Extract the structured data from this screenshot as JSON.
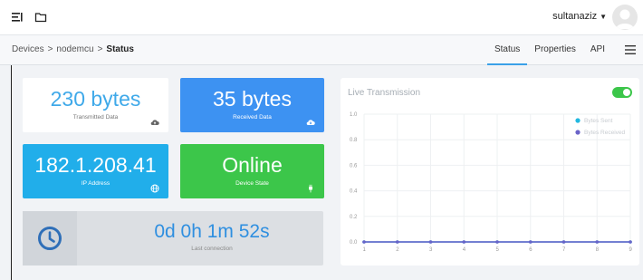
{
  "topbar": {
    "username": "sultanaziz"
  },
  "breadcrumb": {
    "items": [
      "Devices",
      "nodemcu"
    ],
    "separator": ">",
    "current": "Status"
  },
  "tabs": [
    {
      "label": "Status",
      "active": true
    },
    {
      "label": "Properties",
      "active": false
    },
    {
      "label": "API",
      "active": false
    }
  ],
  "tiles": {
    "transmitted": {
      "value": "230 bytes",
      "label": "Transmitted Data",
      "icon": "cloud-upload-icon"
    },
    "received": {
      "value": "35 bytes",
      "label": "Received Data",
      "icon": "cloud-download-icon"
    },
    "ip": {
      "value": "182.1.208.41",
      "label": "IP Address",
      "icon": "globe-icon"
    },
    "state": {
      "value": "Online",
      "label": "Device State",
      "icon": "plug-icon"
    },
    "connection": {
      "value": "0d 0h 1m 52s",
      "label": "Last connection",
      "icon": "clock-icon"
    }
  },
  "chart_card": {
    "title": "Live Transmission",
    "toggle_on": true
  },
  "colors": {
    "accent": "#3aa0e8",
    "blue_tile": "#3d92f2",
    "cyan_tile": "#21aeea",
    "green_tile": "#3cc64a",
    "series_sent": "#21b8e0",
    "series_received": "#6a63c8"
  },
  "chart_data": {
    "type": "line",
    "x": [
      1,
      2,
      3,
      4,
      5,
      6,
      7,
      8,
      9
    ],
    "series": [
      {
        "name": "Bytes Sent",
        "values": [
          0,
          0,
          0,
          0,
          0,
          0,
          0,
          0,
          0
        ]
      },
      {
        "name": "Bytes Received",
        "values": [
          0,
          0,
          0,
          0,
          0,
          0,
          0,
          0,
          0
        ]
      }
    ],
    "ylim": [
      0,
      1.0
    ],
    "yticks": [
      "0.0",
      "0.2",
      "0.4",
      "0.6",
      "0.8",
      "1.0"
    ],
    "xticks": [
      "1",
      "2",
      "3",
      "4",
      "5",
      "6",
      "7",
      "8",
      "9"
    ],
    "grid": true,
    "legend": "top-right"
  }
}
